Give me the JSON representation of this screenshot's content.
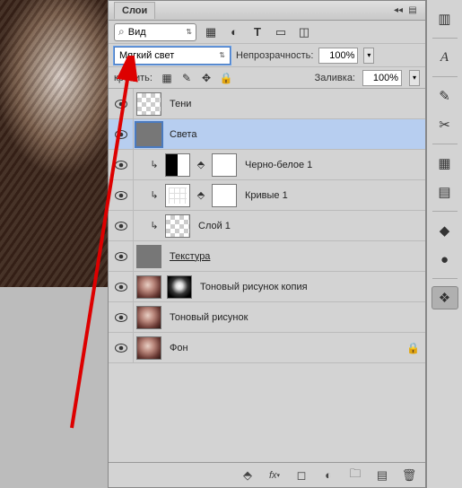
{
  "panel": {
    "title": "Слои"
  },
  "filter": {
    "placeholder": "Вид"
  },
  "blend": {
    "mode": "Мягкий свет"
  },
  "opacity": {
    "label": "Непрозрачность:",
    "value": "100%"
  },
  "lock": {
    "label": "крепить:"
  },
  "fill": {
    "label": "Заливка:",
    "value": "100%"
  },
  "layers": [
    {
      "name": "Тени",
      "kind": "checker"
    },
    {
      "name": "Света",
      "kind": "gray",
      "selected": true
    },
    {
      "name": "Черно-белое 1",
      "kind": "adj-bw",
      "indent": true,
      "clipped": true
    },
    {
      "name": "Кривые 1",
      "kind": "adj-curves",
      "indent": true,
      "clipped": true
    },
    {
      "name": "Слой 1",
      "kind": "checker",
      "indent": true,
      "clipped": true
    },
    {
      "name": "Текстура",
      "kind": "gray",
      "underline": true
    },
    {
      "name": "Тоновый рисунок копия",
      "kind": "photo-dual"
    },
    {
      "name": "Тоновый рисунок",
      "kind": "photo"
    },
    {
      "name": "Фон",
      "kind": "photo",
      "locked": true
    }
  ]
}
